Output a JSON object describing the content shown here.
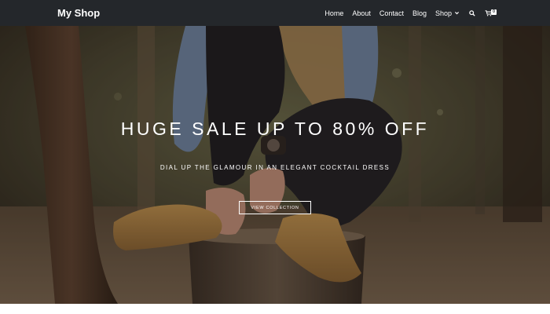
{
  "brand": {
    "name": "My Shop"
  },
  "nav": {
    "items": [
      {
        "label": "Home"
      },
      {
        "label": "About"
      },
      {
        "label": "Contact"
      },
      {
        "label": "Blog"
      },
      {
        "label": "Shop"
      }
    ],
    "cart_count": "0"
  },
  "hero": {
    "title": "HUGE SALE UP TO 80% OFF",
    "subtitle": "DIAL UP THE GLAMOUR IN AN ELEGANT COCKTAIL DRESS",
    "button_label": "VIEW COLLECTION"
  },
  "icons": {
    "search": "search-icon",
    "cart": "cart-icon",
    "dropdown": "chevron-down-icon"
  },
  "colors": {
    "navbar_bg": "#24272b",
    "text": "#ffffff"
  }
}
